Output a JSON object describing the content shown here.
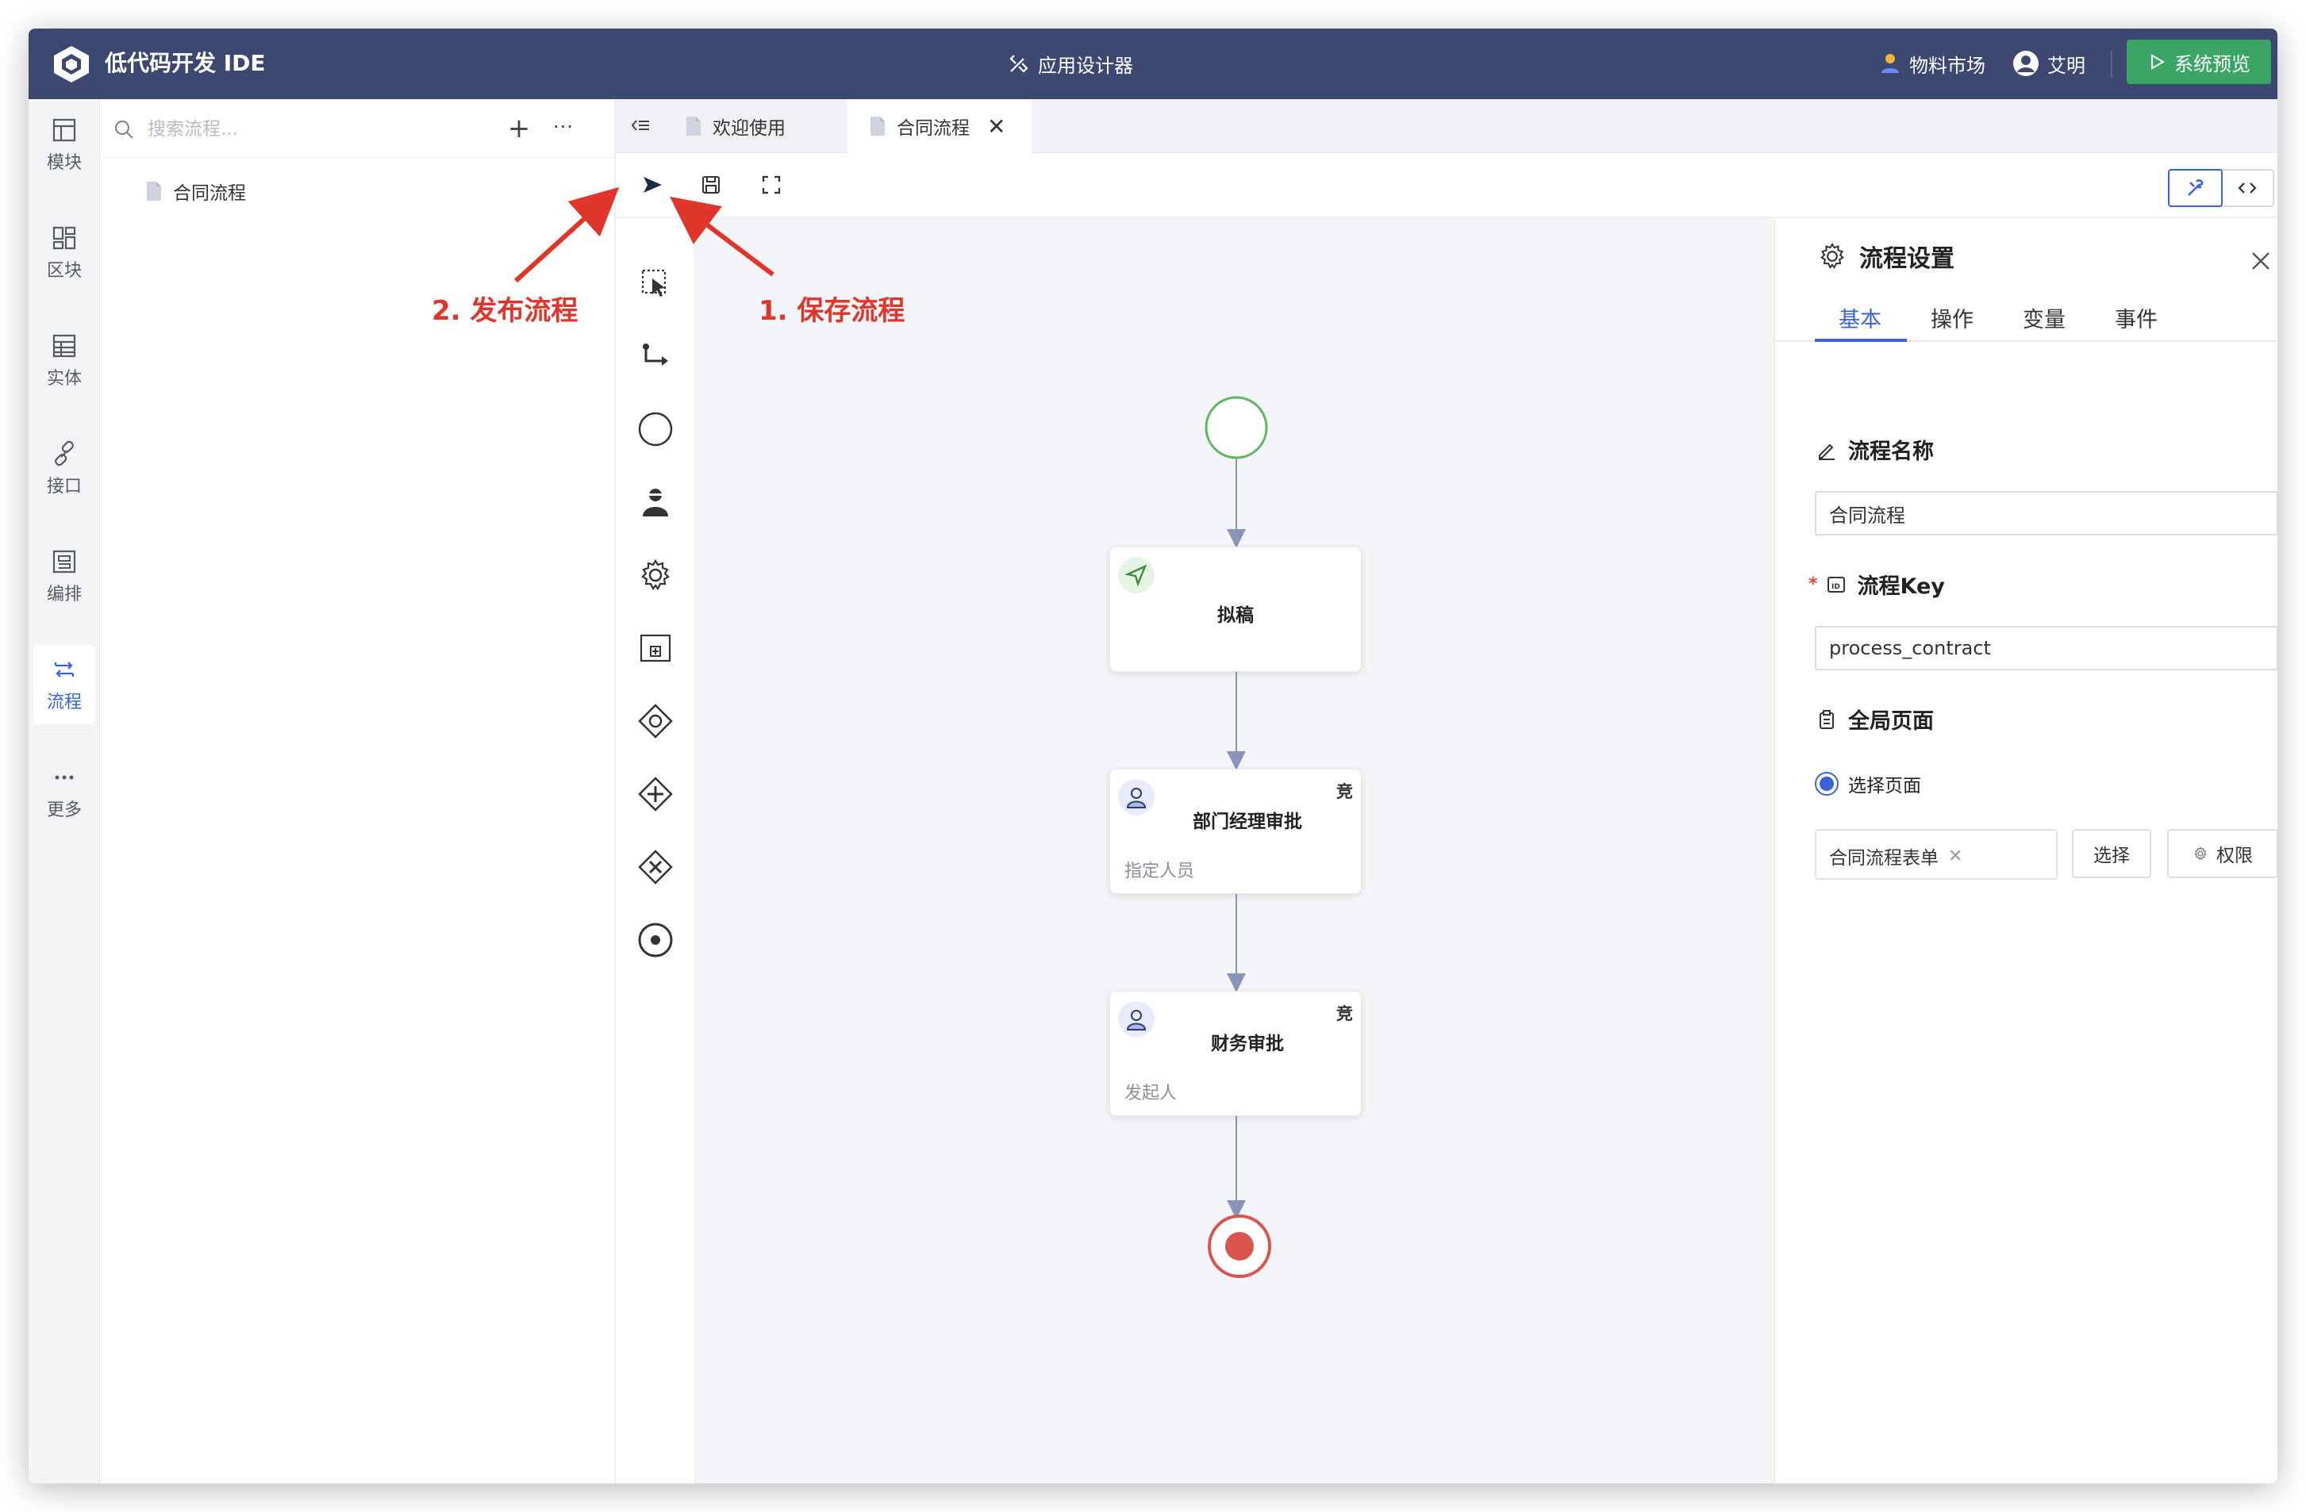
{
  "header": {
    "app_title": "低代码开发 IDE",
    "center_label": "应用设计器",
    "materials_label": "物料市场",
    "user_name": "艾明",
    "preview_label": "系统预览",
    "bg_color": "#3d4870",
    "preview_color": "#3aa564"
  },
  "rail": {
    "items": [
      {
        "label": "模块",
        "icon": "layout-icon"
      },
      {
        "label": "区块",
        "icon": "blocks-icon"
      },
      {
        "label": "实体",
        "icon": "table-icon"
      },
      {
        "label": "接口",
        "icon": "link-icon"
      },
      {
        "label": "编排",
        "icon": "orchestration-icon"
      },
      {
        "label": "流程",
        "icon": "flow-icon",
        "active": true
      },
      {
        "label": "更多",
        "icon": "more-icon"
      }
    ]
  },
  "explorer": {
    "search_placeholder": "搜索流程...",
    "add_symbol": "+",
    "more_symbol": "···",
    "tree": [
      {
        "label": "合同流程"
      }
    ]
  },
  "tabs": [
    {
      "label": "欢迎使用",
      "active": false
    },
    {
      "label": "合同流程",
      "active": true,
      "close": "✕"
    }
  ],
  "canvas": {
    "nodes": [
      {
        "title": "拟稿",
        "type": "start-task"
      },
      {
        "title": "部门经理审批",
        "badge": "竞",
        "subtitle": "指定人员",
        "type": "user-task"
      },
      {
        "title": "财务审批",
        "badge": "竞",
        "subtitle": "发起人",
        "type": "user-task"
      }
    ],
    "colors": {
      "start": "#5cb85c",
      "end": "#d9534f",
      "edge": "#8a93b8",
      "accent": "#3a63d8"
    }
  },
  "props": {
    "title": "流程设置",
    "tabs": [
      "基本",
      "操作",
      "变量",
      "事件"
    ],
    "active_tab": "基本",
    "name_label": "流程名称",
    "name_value": "合同流程",
    "key_required": "*",
    "key_label": "流程Key",
    "key_value": "process_contract",
    "page_label": "全局页面",
    "radio_label": "选择页面",
    "page_tag": "合同流程表单",
    "page_tag_remove": "✕",
    "select_btn": "选择",
    "perm_btn": "权限"
  },
  "annotations": {
    "publish": "2. 发布流程",
    "save": "1. 保存流程",
    "color": "#e0352b"
  }
}
